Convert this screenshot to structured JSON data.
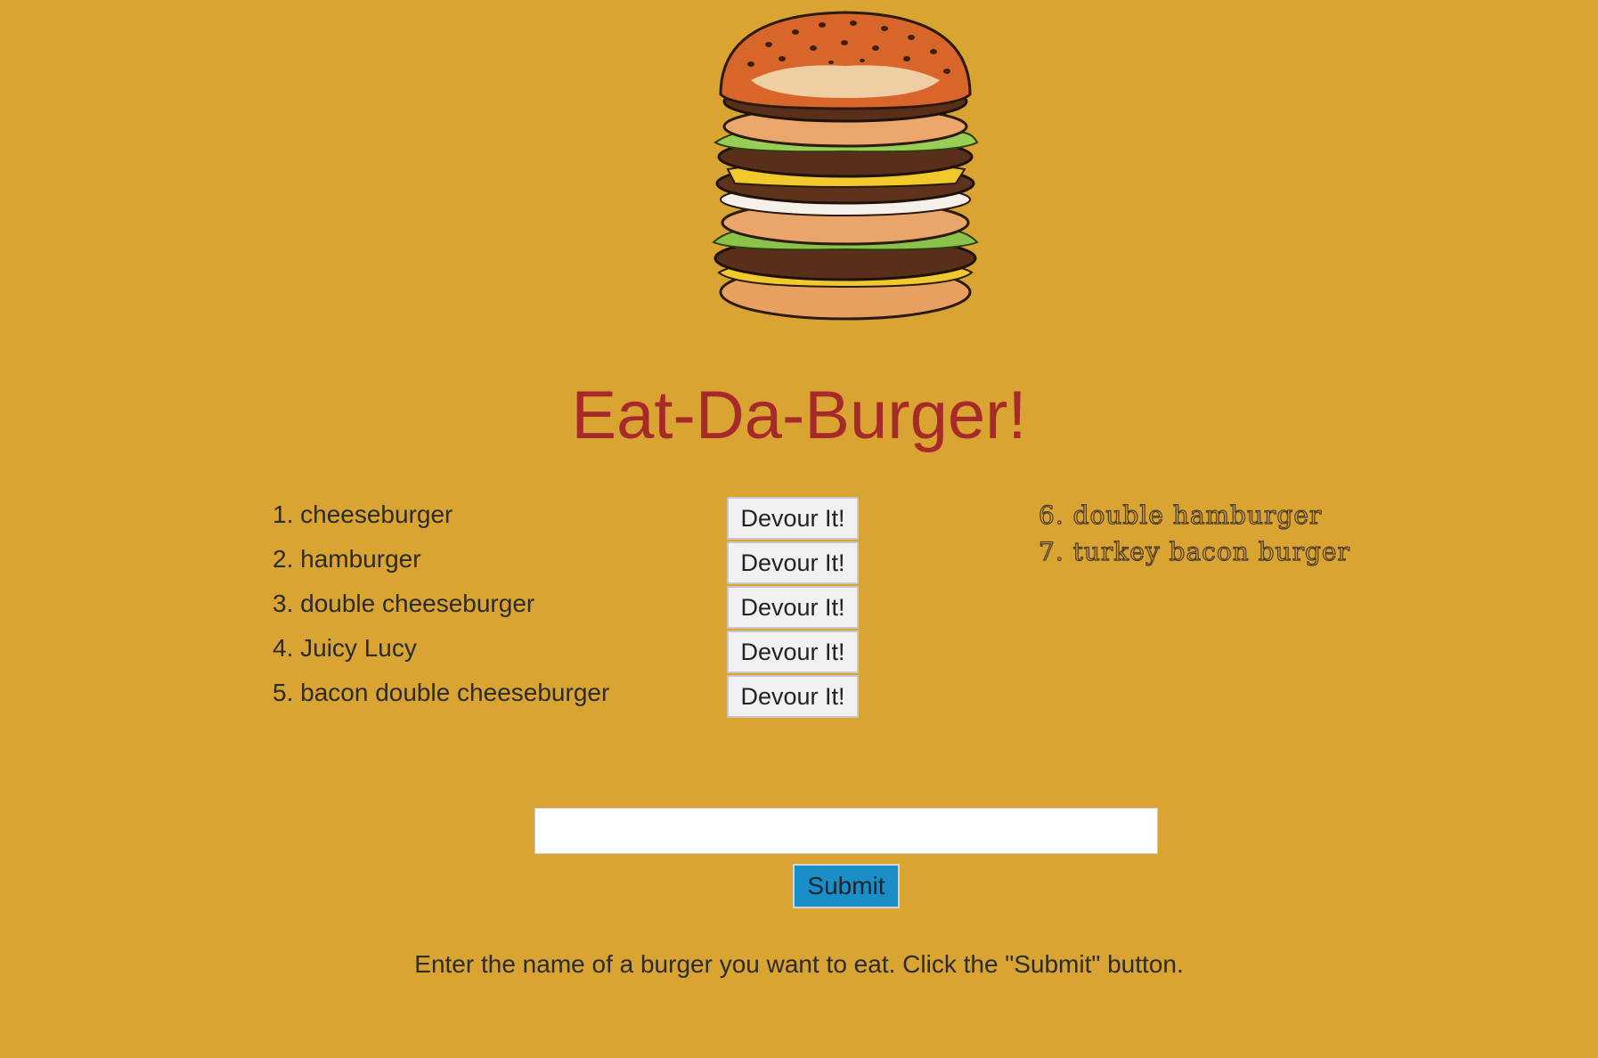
{
  "header": {
    "image_label": "stacked-burger",
    "title": "Eat-Da-Burger!"
  },
  "uneaten_burgers": [
    {
      "name": "1. cheeseburger",
      "button_label": "Devour It!"
    },
    {
      "name": "2. hamburger",
      "button_label": "Devour It!"
    },
    {
      "name": "3. double cheeseburger",
      "button_label": "Devour It!"
    },
    {
      "name": "4. Juicy Lucy",
      "button_label": "Devour It!"
    },
    {
      "name": "5. bacon double cheeseburger",
      "button_label": "Devour It!"
    }
  ],
  "devoured_burgers": [
    {
      "name": "6. double hamburger"
    },
    {
      "name": "7. turkey bacon burger"
    }
  ],
  "form": {
    "input_value": "",
    "input_placeholder": "",
    "submit_label": "Submit",
    "instructions": "Enter the name of a burger you want to eat. Click the \"Submit\" button."
  },
  "colors": {
    "background": "#d9a431",
    "title": "#a72a2a",
    "submit_button": "#1a8fc7",
    "devour_button": "#f1f1f1"
  }
}
